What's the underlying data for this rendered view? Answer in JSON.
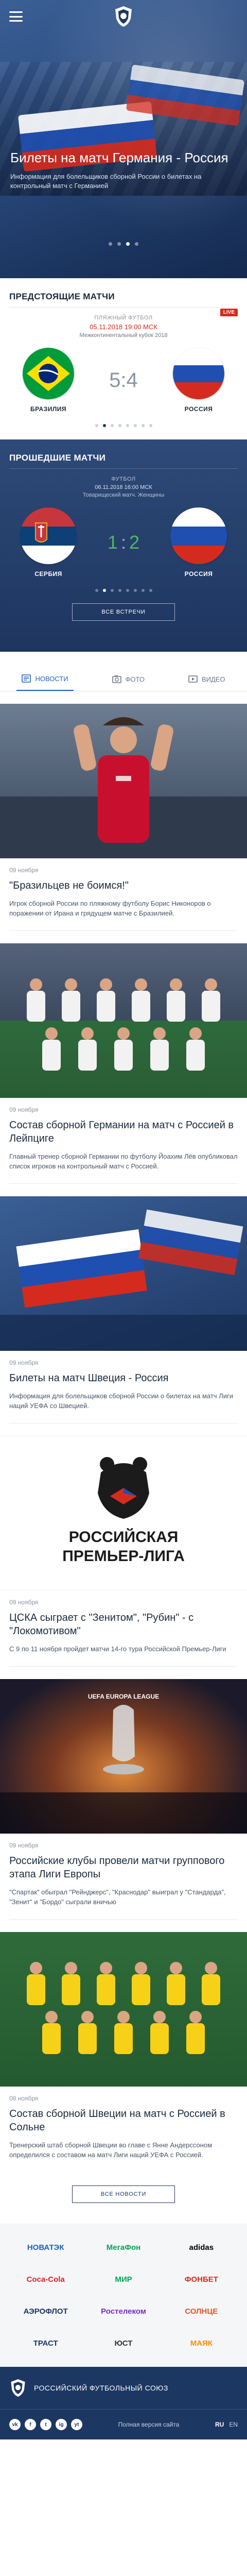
{
  "hero": {
    "title": "Билеты на матч Германия - Россия",
    "subtitle": "Информация для болельщиков сборной России о билетах на контрольный матч с Германией",
    "slides_total": 4,
    "active_slide": 2
  },
  "upcoming": {
    "title": "ПРЕДСТОЯЩИЕ МАТЧИ",
    "live_badge": "LIVE",
    "sport": "ПЛЯЖНЫЙ ФУТБОЛ",
    "datetime": "05.11.2018 19:00 МСК",
    "tournament": "Межконтинентальный кубок 2018",
    "home_team": "БРАЗИЛИЯ",
    "away_team": "РОССИЯ",
    "score": "5:4",
    "pages_total": 8,
    "active_page": 1
  },
  "past": {
    "title": "ПРОШЕДШИЕ МАТЧИ",
    "sport": "ФУТБОЛ",
    "datetime": "06.11.2018 16:00 МСК",
    "tournament": "Товарищеский матч. Женщины",
    "home_team": "СЕРБИЯ",
    "away_team": "РОССИЯ",
    "score_home": "1",
    "score_sep": ":",
    "score_away": "2",
    "pages_total": 8,
    "active_page": 1,
    "all_button": "ВСЕ ВСТРЕЧИ"
  },
  "tabs": [
    {
      "label": "НОВОСТИ",
      "icon": "news-icon",
      "active": true
    },
    {
      "label": "ФОТО",
      "icon": "photo-icon",
      "active": false
    },
    {
      "label": "ВИДЕО",
      "icon": "video-icon",
      "active": false
    }
  ],
  "news": [
    {
      "date": "09 ноября",
      "title": "\"Бразильцев не боимся!\"",
      "text": "Игрок сборной России по пляжному футболу Борис Никоноров о поражении от Ирана и грядущем матче с Бразилией.",
      "image": "player-applause"
    },
    {
      "date": "09 ноября",
      "title": "Состав сборной Германии на матч с Россией в Лейпциге",
      "text": "Главный тренер сборной Германии по футболу Йоахим Лёв опубликовал список игроков на контрольный матч с Россией.",
      "image": "team-photo-germany"
    },
    {
      "date": "09 ноября",
      "title": "Билеты на матч Швеция - Россия",
      "text": "Информация для болельщиков сборной России о билетах на матч Лиги наций УЕФА со Швецией.",
      "image": "fans-flags"
    },
    {
      "date": "09 ноября",
      "title": "ЦСКА сыграет с \"Зенитом\", \"Рубин\" - с \"Локомотивом\"",
      "text": "С 9 по 11 ноября пройдет матчи 14-го тура Российской Премьер-Лиги",
      "image": "rpl-logo",
      "logo_line1": "РОССИЙСКАЯ",
      "logo_line2": "ПРЕМЬЕР-ЛИГА"
    },
    {
      "date": "09 ноября",
      "title": "Российские клубы провели матчи группового этапа Лиги Европы",
      "text": "\"Спартак\" обыграл \"Рейнджерс\", \"Краснодар\" выиграл у \"Стандарда\", \"Зенит\" и \"Бордо\" сыграли вничью",
      "image": "europa-league-trophy",
      "logo_text": "UEFA EUROPA LEAGUE"
    },
    {
      "date": "08 ноября",
      "title": "Состав сборной Швеции на матч с Россией в Сольне",
      "text": "Тренерский штаб сборной Швеции во главе с Янне Андерссоном определился с составом на матч Лиги наций УЕФА с Россией.",
      "image": "team-photo-sweden"
    }
  ],
  "more_news_button": "ВСЕ НОВОСТИ",
  "sponsors": [
    {
      "name": "НОВАТЭК",
      "color": "#1d62b8"
    },
    {
      "name": "МегаФон",
      "color": "#00a651"
    },
    {
      "name": "adidas",
      "color": "#000000"
    },
    {
      "name": "Coca-Cola",
      "color": "#e41e2b"
    },
    {
      "name": "МИР",
      "color": "#00a651"
    },
    {
      "name": "ФОНБЕТ",
      "color": "#d52b1e"
    },
    {
      "name": "АЭРОФЛОТ",
      "color": "#1d3763"
    },
    {
      "name": "Ростелеком",
      "color": "#7b2cbf"
    },
    {
      "name": "СОЛНЦЕ",
      "color": "#e5532d"
    },
    {
      "name": "ТРАСТ",
      "color": "#1d3763"
    },
    {
      "name": "ЮСТ",
      "color": "#333333"
    },
    {
      "name": "МАЯК",
      "color": "#ff8c00"
    }
  ],
  "footer": {
    "org_name": "РОССИЙСКИЙ ФУТБОЛЬНЫЙ СОЮЗ",
    "socials": [
      "vk",
      "f",
      "t",
      "ig",
      "yt"
    ],
    "full_version": "Полная версия сайта",
    "langs": [
      "RU",
      "EN"
    ]
  },
  "colors": {
    "primary": "#1d3763",
    "accent": "#d52b1e",
    "link": "#1d62b8",
    "win": "#4fb56a"
  }
}
